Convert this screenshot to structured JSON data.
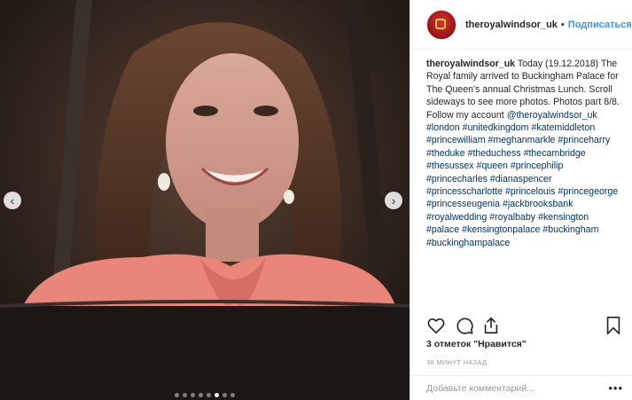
{
  "post": {
    "author": "theroyalwindsor_uk",
    "follow_label": "Подписаться",
    "separator": "•",
    "caption_text": "Today (19.12.2018) The Royal family arrived to Buckingham Palace for The Queen's annual Christmas Lunch. Scroll sideways to see more photos. Photos part 8/8. Follow my account",
    "mention": "@theroyalwindsor_uk",
    "hashtags": [
      "#london",
      "#unitedkingdom",
      "#katemiddleton",
      "#princewilliam",
      "#meghanmarkle",
      "#princeharry",
      "#theduke",
      "#theduchess",
      "#thecambridge",
      "#thesussex",
      "#queen",
      "#princephilip",
      "#princecharles",
      "#dianaspencer",
      "#princesscharlotte",
      "#princelouis",
      "#princegeorge",
      "#princesseugenia",
      "#jackbrooksbank",
      "#royalwedding",
      "#royalbaby",
      "#kensington",
      "#palace",
      "#kensingtonpalace",
      "#buckingham",
      "#buckinghampalace"
    ],
    "likes": "3 отметок \"Нравится\"",
    "time": "38 МИНУТ НАЗАД",
    "comment_placeholder": "Добавьте комментарий...",
    "more_label": "•••"
  },
  "carousel": {
    "total": 8,
    "active_index": 5,
    "prev_label": "‹",
    "next_label": "›"
  },
  "icons": {
    "like": "heart-icon",
    "comment": "comment-icon",
    "share": "share-icon",
    "save": "bookmark-icon"
  },
  "colors": {
    "follow": "#3897f0",
    "hashtag": "#003569",
    "dress": "#e98579"
  }
}
